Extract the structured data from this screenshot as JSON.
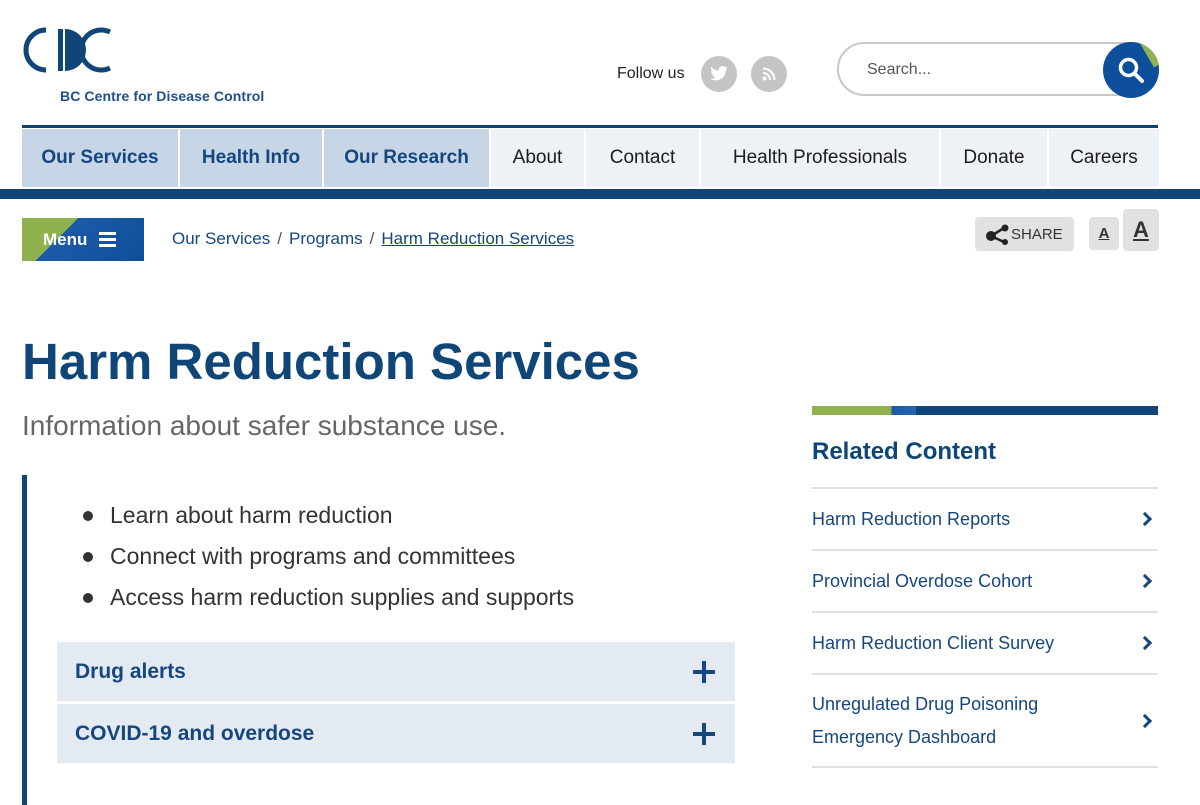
{
  "header": {
    "logo_text": "BC Centre for Disease Control",
    "follow_label": "Follow us",
    "social_icons": [
      "twitter-icon",
      "rss-icon"
    ],
    "search_placeholder": "Search..."
  },
  "nav": {
    "items": [
      {
        "label": "Our Services",
        "style": "primary"
      },
      {
        "label": "Health Info",
        "style": "primary"
      },
      {
        "label": "Our Research",
        "style": "primary"
      },
      {
        "label": "About",
        "style": "secondary"
      },
      {
        "label": "Contact",
        "style": "secondary"
      },
      {
        "label": "Health Professionals",
        "style": "secondary"
      },
      {
        "label": "Donate",
        "style": "secondary"
      },
      {
        "label": "Careers",
        "style": "secondary"
      }
    ]
  },
  "toolbar": {
    "menu_label": "Menu",
    "share_label": "SHARE",
    "font_small_label": "A",
    "font_large_label": "A"
  },
  "breadcrumb": {
    "items": [
      "Our Services",
      "Programs",
      "Harm Reduction Services"
    ],
    "separator": "/"
  },
  "main": {
    "title": "Harm Reduction Services",
    "subtitle": "Information about safer substance use.",
    "bullets": [
      "Learn about harm reduction",
      "Connect with programs and committees",
      "Access harm reduction supplies and supports"
    ],
    "accordions": [
      "Drug alerts",
      "COVID-19 and overdose"
    ]
  },
  "sidebar": {
    "title": "Related Content",
    "items": [
      "Harm Reduction Reports",
      "Provincial Overdose Cohort",
      "Harm Reduction Client Survey",
      "Unregulated Drug Poisoning Emergency Dashboard"
    ]
  },
  "colors": {
    "brand_blue": "#0f4577",
    "link_blue": "#15467f",
    "accent_green": "#8fb24e"
  }
}
